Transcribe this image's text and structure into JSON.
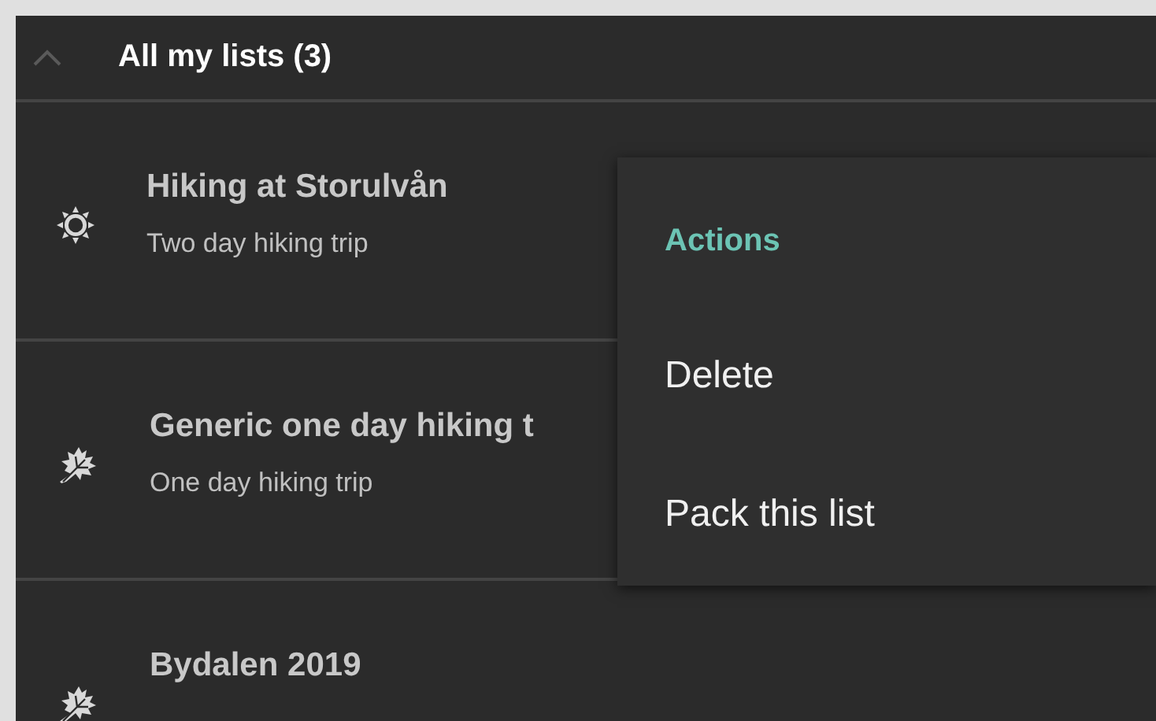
{
  "header": {
    "title": "All my lists (3)",
    "expanded": true
  },
  "lists": [
    {
      "kind": "sun",
      "title": "Hiking at Storulvån",
      "subtitle": "Two day hiking trip"
    },
    {
      "kind": "leaf",
      "title": "Generic one day hiking t",
      "subtitle": "One day hiking trip"
    },
    {
      "kind": "leaf",
      "title": "Bydalen 2019"
    }
  ],
  "menu": {
    "title": "Actions",
    "items": [
      "Delete",
      "Pack this list"
    ]
  }
}
